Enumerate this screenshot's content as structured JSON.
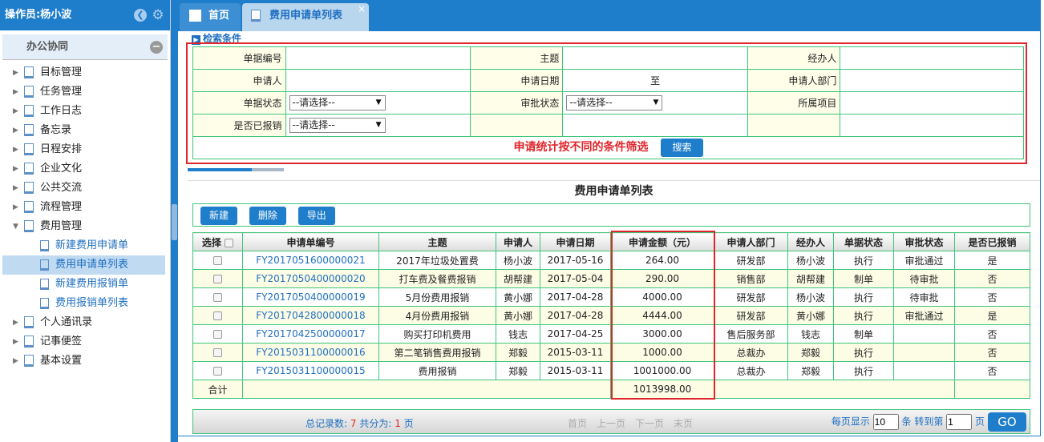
{
  "sidebar": {
    "operator": "操作员:杨小波",
    "group": "办公协同",
    "items": [
      "目标管理",
      "任务管理",
      "工作日志",
      "备忘录",
      "日程安排",
      "企业文化",
      "公共交流",
      "流程管理",
      "费用管理"
    ],
    "sub_items": [
      "新建费用申请单",
      "费用申请单列表",
      "新建费用报销单",
      "费用报销单列表"
    ],
    "items_after": [
      "个人通讯录",
      "记事便签",
      "基本设置"
    ]
  },
  "tabs": [
    "首页",
    "费用申请单列表"
  ],
  "search": {
    "title": "检索条件",
    "labels": [
      "单据编号",
      "主题",
      "经办人",
      "申请人",
      "申请日期",
      "申请人部门",
      "单据状态",
      "审批状态",
      "所属项目",
      "是否已报销"
    ],
    "date_sep": "至",
    "select_placeholder": "--请选择--",
    "hint": "申请统计按不同的条件筛选",
    "search_btn": "搜索"
  },
  "list": {
    "title": "费用申请单列表",
    "buttons": [
      "新建",
      "删除",
      "导出"
    ],
    "columns": [
      "选择",
      "申请单编号",
      "主题",
      "申请人",
      "申请日期",
      "申请金额（元）",
      "申请人部门",
      "经办人",
      "单据状态",
      "审批状态",
      "是否已报销"
    ],
    "rows": [
      [
        "FY2017051600000021",
        "2017年垃圾处置费",
        "杨小波",
        "2017-05-16",
        "264.00",
        "研发部",
        "杨小波",
        "执行",
        "审批通过",
        "是"
      ],
      [
        "FY2017050400000020",
        "打车费及餐费报销",
        "胡帮建",
        "2017-05-04",
        "290.00",
        "销售部",
        "胡帮建",
        "制单",
        "待审批",
        "否"
      ],
      [
        "FY2017050400000019",
        "5月份费用报销",
        "黄小娜",
        "2017-04-28",
        "4000.00",
        "研发部",
        "杨小波",
        "执行",
        "待审批",
        "否"
      ],
      [
        "FY2017042800000018",
        "4月份费用报销",
        "黄小娜",
        "2017-04-28",
        "4444.00",
        "研发部",
        "黄小娜",
        "执行",
        "审批通过",
        "是"
      ],
      [
        "FY2017042500000017",
        "购买打印机费用",
        "钱志",
        "2017-04-25",
        "3000.00",
        "售后服务部",
        "钱志",
        "制单",
        "",
        "否"
      ],
      [
        "FY2015031100000016",
        "第二笔销售费用报销",
        "郑毅",
        "2015-03-11",
        "1000.00",
        "总裁办",
        "郑毅",
        "执行",
        "",
        "否"
      ],
      [
        "FY2015031100000015",
        "费用报销",
        "郑毅",
        "2015-03-11",
        "1001000.00",
        "总裁办",
        "郑毅",
        "执行",
        "",
        "否"
      ]
    ],
    "total_label": "合计",
    "total": "1013998.00"
  },
  "pager": {
    "total_label": "总记录数:",
    "total": "7",
    "pages_label": "共分为:",
    "pages": "1",
    "page_unit": "页",
    "first": "首页",
    "prev": "上一页",
    "next": "下一页",
    "last": "末页",
    "per_page_label": "每页显示",
    "per_page": "10",
    "goto_label": "条 转到第",
    "goto": "1",
    "go": "GO"
  }
}
